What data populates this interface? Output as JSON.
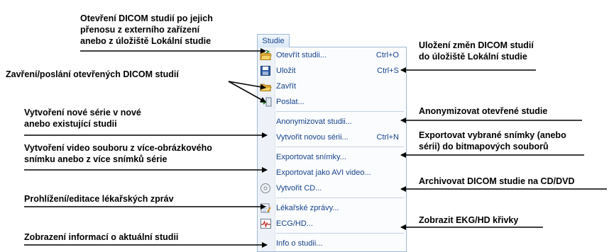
{
  "menu": {
    "tab": "Studie",
    "items": [
      {
        "label": "Otevřít studii...",
        "shortcut": "Ctrl+O",
        "icon": "open-folder-icon"
      },
      {
        "label": "Uložit",
        "shortcut": "Ctrl+S",
        "icon": "save-disk-icon"
      },
      {
        "label": "Zavřít",
        "shortcut": "",
        "icon": "close-folder-icon"
      },
      {
        "label": "Poslat...",
        "shortcut": "",
        "icon": "send-icon"
      },
      {
        "label": "Anonymizovat studii...",
        "shortcut": "",
        "icon": ""
      },
      {
        "label": "Vytvořit novou sérii...",
        "shortcut": "Ctrl+N",
        "icon": ""
      },
      {
        "label": "Exportovat snímky...",
        "shortcut": "",
        "icon": ""
      },
      {
        "label": "Exportovat jako AVI video...",
        "shortcut": "",
        "icon": ""
      },
      {
        "label": "Vytvořit CD...",
        "shortcut": "",
        "icon": "cd-icon"
      },
      {
        "label": "Lékařské zprávy...",
        "shortcut": "",
        "icon": "report-icon"
      },
      {
        "label": "ECG/HD...",
        "shortcut": "",
        "icon": "ecg-icon"
      },
      {
        "label": "Info o studii...",
        "shortcut": "",
        "icon": ""
      }
    ]
  },
  "annotations": {
    "left": [
      "Otevření DICOM studií po jejich\npřenosu z externího zařízení\nanebo z úložiště Lokální studie",
      "Zavření/poslání otevřených DICOM studií",
      "Vytvoření nové série v nové\nanebo existující studii",
      "Vytvoření video souboru z více-obrázkového\nsnímku anebo z více snímků série",
      "Prohlížení/editace lékařských zpráv",
      "Zobrazení informací o aktuální studii"
    ],
    "right": [
      "Uložení změn DICOM studií\ndo úložiště Lokální studie",
      "Anonymizovat otevřené studie",
      "Exportovat vybrané snímky (anebo\nsérii) do bitmapových souborů",
      "Archivovat DICOM studie na CD/DVD",
      "Zobrazit EKG/HD křivky"
    ]
  }
}
